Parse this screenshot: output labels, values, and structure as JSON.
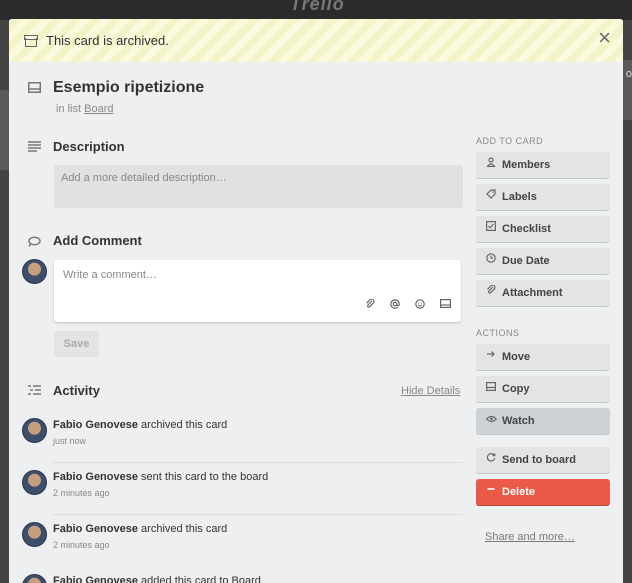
{
  "backdrop": {
    "logo": "Trello",
    "edge_letter": "o"
  },
  "banner": {
    "text": "This card is archived.",
    "close": "×"
  },
  "card": {
    "title": "Esempio ripetizione",
    "in_list_prefix": "in list",
    "list_name": "Board"
  },
  "description": {
    "title": "Description",
    "placeholder": "Add a more detailed description…"
  },
  "comment": {
    "title": "Add Comment",
    "placeholder": "Write a comment…",
    "save_label": "Save",
    "tools": [
      "attachment-icon",
      "mention-icon",
      "emoji-icon",
      "card-icon"
    ]
  },
  "activity": {
    "title": "Activity",
    "hide_details": "Hide Details",
    "items": [
      {
        "user": "Fabio Genovese",
        "action": "archived this card",
        "time": "just now"
      },
      {
        "user": "Fabio Genovese",
        "action": "sent this card to the board",
        "time": "2 minutes ago"
      },
      {
        "user": "Fabio Genovese",
        "action": "archived this card",
        "time": "2 minutes ago"
      },
      {
        "user": "Fabio Genovese",
        "action": "added this card to Board",
        "time": ""
      }
    ]
  },
  "sidebar": {
    "add_label": "ADD TO CARD",
    "add_buttons": [
      {
        "label": "Members",
        "icon": "person-icon"
      },
      {
        "label": "Labels",
        "icon": "tag-icon"
      },
      {
        "label": "Checklist",
        "icon": "checkbox-icon"
      },
      {
        "label": "Due Date",
        "icon": "clock-icon"
      },
      {
        "label": "Attachment",
        "icon": "paperclip-icon"
      }
    ],
    "actions_label": "ACTIONS",
    "action_buttons": [
      {
        "label": "Move",
        "icon": "arrow-right-icon"
      },
      {
        "label": "Copy",
        "icon": "copy-icon"
      },
      {
        "label": "Watch",
        "icon": "eye-icon"
      },
      {
        "label": "Send to board",
        "icon": "refresh-icon"
      },
      {
        "label": "Delete",
        "icon": "minus-icon"
      }
    ],
    "share_label": "Share and more…"
  },
  "colors": {
    "danger": "#eb5a46",
    "banner_stripe": "#f3f3c8",
    "modal_bg": "#edeff0"
  }
}
